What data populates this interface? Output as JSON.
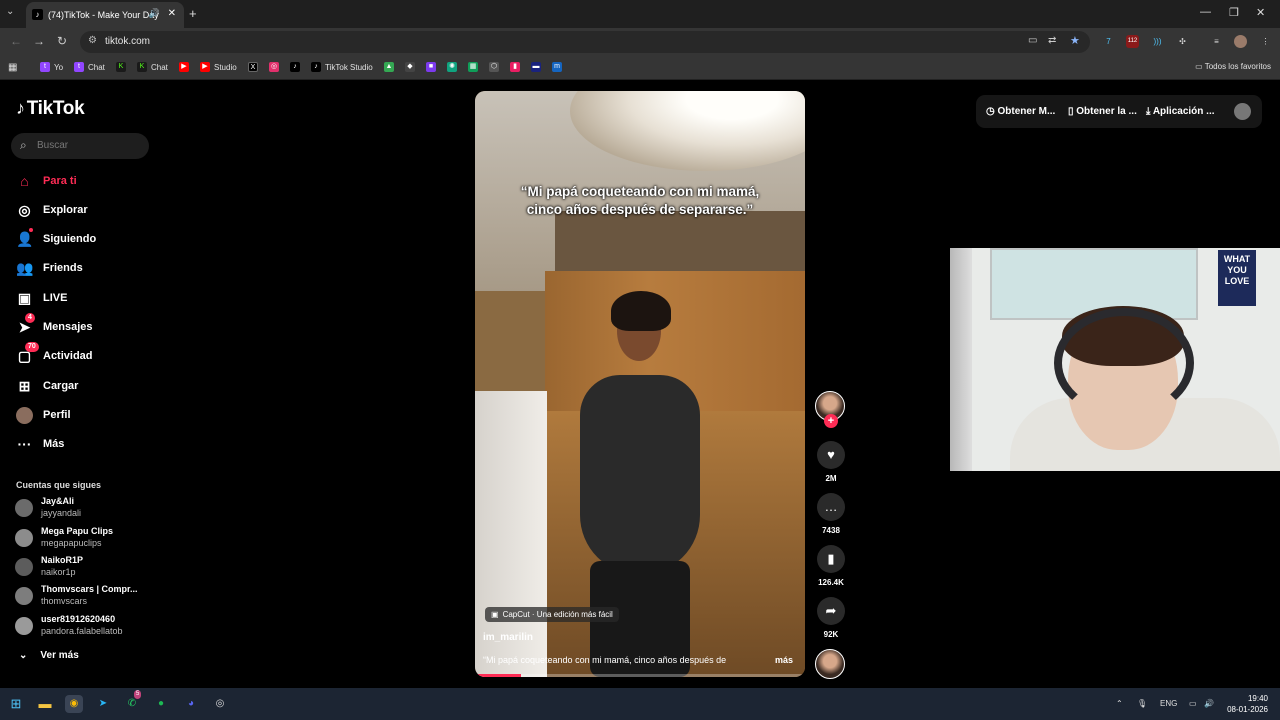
{
  "browser": {
    "tab_title": "(74)TikTok - Make Your Day",
    "tab_favicon": "tiktok-icon",
    "url": "tiktok.com",
    "bookmarks": [
      {
        "label": "Yo",
        "icon": "twitch-icon",
        "color": "#9146ff"
      },
      {
        "label": "Chat",
        "icon": "twitch-icon",
        "color": "#9146ff"
      },
      {
        "label": "",
        "icon": "kick-icon",
        "color": "#53fc18"
      },
      {
        "label": "Chat",
        "icon": "kick-icon",
        "color": "#53fc18"
      },
      {
        "label": "",
        "icon": "youtube-icon",
        "color": "#ff0000"
      },
      {
        "label": "Studio",
        "icon": "youtube-studio-icon",
        "color": "#ff0000"
      },
      {
        "label": "",
        "icon": "x-icon",
        "color": "#000000"
      },
      {
        "label": "",
        "icon": "instagram-icon",
        "color": "#e1306c"
      },
      {
        "label": "",
        "icon": "tiktok-icon",
        "color": "#000000"
      },
      {
        "label": "TikTok Studio",
        "icon": "tiktok-icon",
        "color": "#000000"
      }
    ],
    "all_favorites": "Todos los favoritos",
    "extension_badge": "112"
  },
  "sidebar": {
    "logo": "TikTok",
    "search_placeholder": "Buscar",
    "nav": [
      {
        "label": "Para ti",
        "icon": "home-icon",
        "active": true
      },
      {
        "label": "Explorar",
        "icon": "compass-icon"
      },
      {
        "label": "Siguiendo",
        "icon": "following-icon"
      },
      {
        "label": "Friends",
        "icon": "friends-icon"
      },
      {
        "label": "LIVE",
        "icon": "live-icon"
      },
      {
        "label": "Mensajes",
        "icon": "message-icon",
        "badge": "4"
      },
      {
        "label": "Actividad",
        "icon": "activity-icon",
        "badge": "70"
      },
      {
        "label": "Cargar",
        "icon": "upload-icon"
      },
      {
        "label": "Perfil",
        "icon": "avatar-icon"
      },
      {
        "label": "Más",
        "icon": "more-icon"
      }
    ],
    "following_title": "Cuentas que sigues",
    "accounts": [
      {
        "name": "Jay&Ali",
        "handle": "jayyandali"
      },
      {
        "name": "Mega Papu Clips",
        "handle": "megapapuclips"
      },
      {
        "name": "NaikoR1P",
        "handle": "naikor1p"
      },
      {
        "name": "Thomvscars | Compr...",
        "handle": "thomvscars"
      },
      {
        "name": "user81912620460",
        "handle": "pandora.falabellatob"
      }
    ],
    "see_more": "Ver más"
  },
  "video": {
    "overlay_caption": "“Mi papá coqueteando con mi mamá, cinco años después de separarse.”",
    "capcut_label": "CapCut · Una edición más fácil",
    "author": "im_marilin",
    "description": "“Mi papá coqueteando con mi mamá, cinco años después de",
    "more": "más",
    "progress": 0.14
  },
  "actions": {
    "likes": "2M",
    "comments": "7438",
    "saves": "126.4K",
    "shares": "92K"
  },
  "top_right": {
    "item1": "Obtener M...",
    "item2": "Obtener la ...",
    "item3": "Aplicación ..."
  },
  "webcam": {
    "poster_text": "WHAT YOU LOVE"
  },
  "taskbar": {
    "lang": "ENG",
    "time": "19:40",
    "date": "08-01-2026",
    "whatsapp_badge": "5"
  }
}
